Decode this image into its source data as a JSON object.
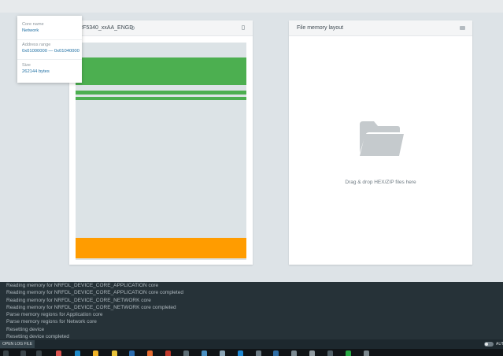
{
  "device_panel": {
    "title": "RF5340_xxAA_ENGD",
    "region_colors": [
      "#4caf50",
      "#4caf50",
      "#4caf50",
      "#ff9c00"
    ]
  },
  "tooltip": {
    "core_label": "Core name",
    "core_value": "Network",
    "address_label": "Address range",
    "address_value": "0x01000000 — 0x01040000",
    "size_label": "Size",
    "size_value": "262144 bytes"
  },
  "file_panel": {
    "title": "File memory layout",
    "drop_text": "Drag & drop HEX/ZIP files here"
  },
  "log": {
    "lines": [
      "Reading memory for NRFDL_DEVICE_CORE_APPLICATION core",
      "Reading memory for NRFDL_DEVICE_CORE_APPLICATION core completed",
      "Reading memory for NRFDL_DEVICE_CORE_NETWORK core",
      "Reading memory for NRFDL_DEVICE_CORE_NETWORK core completed",
      "Parse memory regions for Application core",
      "Parse memory regions for Network core",
      "Resetting device",
      "Resetting device completed"
    ]
  },
  "statusbar": {
    "open_log_label": "OPEN LOG FILE",
    "auto_label": "AUT"
  },
  "colors": {
    "accent_green": "#4caf50",
    "accent_orange": "#ff9c00",
    "log_background": "#263238",
    "link_blue": "#1f6fa3"
  },
  "taskbar": {
    "icons": [
      "red-app-icon",
      "edge-icon",
      "explorer-icon",
      "chrome-icon",
      "terminal-icon",
      "notepad-icon",
      "vscode-icon",
      "python-icon",
      "app-icon"
    ]
  }
}
